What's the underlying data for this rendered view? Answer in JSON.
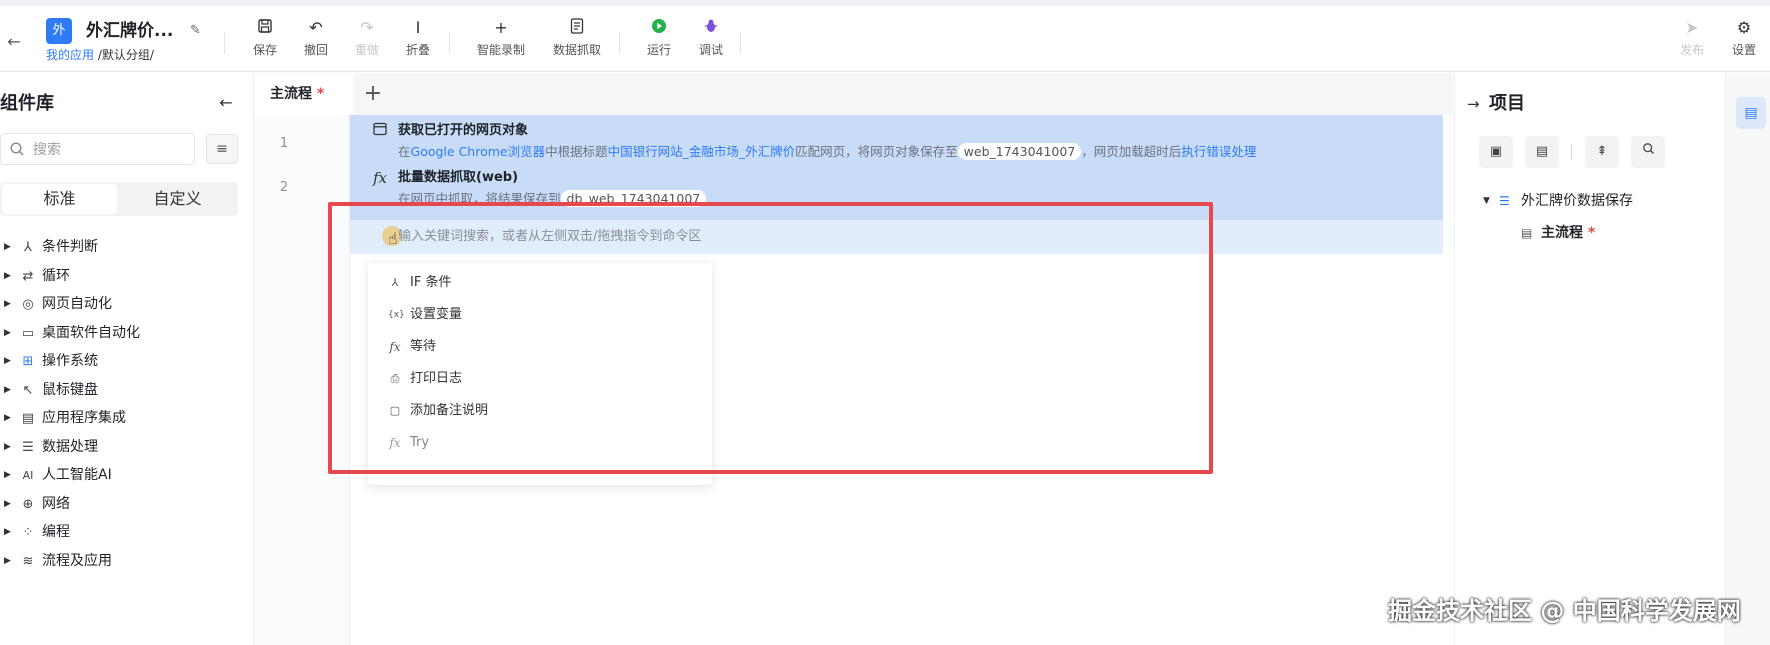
{
  "header": {
    "app_badge": "外",
    "app_name": "外汇牌价...",
    "breadcrumb_link": "我的应用",
    "breadcrumb_rest": " /默认分组/",
    "toolbar": [
      {
        "label": "保存",
        "icon": "save-icon"
      },
      {
        "label": "撤回",
        "icon": "undo-icon"
      },
      {
        "label": "重做",
        "icon": "redo-icon",
        "disabled": true
      },
      {
        "label": "折叠",
        "icon": "collapse-icon"
      },
      {
        "label": "智能录制",
        "icon": "plus-icon"
      },
      {
        "label": "数据抓取",
        "icon": "document-icon"
      },
      {
        "label": "运行",
        "icon": "play-icon",
        "color": "#22b14c"
      },
      {
        "label": "调试",
        "icon": "bug-icon",
        "color": "#7b4fe0"
      },
      {
        "label": "发布",
        "icon": "send-icon",
        "disabled": true
      },
      {
        "label": "设置",
        "icon": "gear-icon"
      }
    ]
  },
  "left": {
    "title": "组件库",
    "search_placeholder": "搜索",
    "tabs": [
      "标准",
      "自定义"
    ],
    "categories": [
      {
        "label": "条件判断",
        "icon": "branch-icon"
      },
      {
        "label": "循环",
        "icon": "loop-icon"
      },
      {
        "label": "网页自动化",
        "icon": "chrome-icon"
      },
      {
        "label": "桌面软件自动化",
        "icon": "monitor-icon"
      },
      {
        "label": "操作系统",
        "icon": "windows-icon"
      },
      {
        "label": "鼠标键盘",
        "icon": "cursor-icon"
      },
      {
        "label": "应用程序集成",
        "icon": "app-integration-icon"
      },
      {
        "label": "数据处理",
        "icon": "database-icon"
      },
      {
        "label": "人工智能AI",
        "icon": "ai-icon"
      },
      {
        "label": "网络",
        "icon": "globe-icon"
      },
      {
        "label": "编程",
        "icon": "code-icon"
      },
      {
        "label": "流程及应用",
        "icon": "layers-icon"
      }
    ]
  },
  "editor": {
    "tab_label": "主流程",
    "tab_marker": " *",
    "line_numbers": [
      "1",
      "2"
    ],
    "cmd1": {
      "title": "获取已打开的网页对象",
      "d1": "在",
      "d2": "Google Chrome浏览器",
      "d3": "中根据标题",
      "d4": "中国银行网站_金融市场_外汇牌价",
      "d5": "匹配网页，将网页对象保存至",
      "d6": "web_1743041007",
      "d7": "，网页加载超时后",
      "d8": "执行错误处理"
    },
    "cmd2": {
      "title": "批量数据抓取(web)",
      "d1": "在网页中抓取，将结果保存到",
      "d2": "db_web_1743041007"
    },
    "input_placeholder": "输入关键词搜索，或者从左侧双击/拖拽指令到命令区",
    "dropdown": [
      {
        "label": "IF 条件",
        "icon": "branch-icon"
      },
      {
        "label": "设置变量",
        "icon": "variable-icon"
      },
      {
        "label": "等待",
        "icon": "function-icon"
      },
      {
        "label": "打印日志",
        "icon": "printer-icon"
      },
      {
        "label": "添加备注说明",
        "icon": "note-icon"
      },
      {
        "label": "Try",
        "icon": "function-icon"
      }
    ]
  },
  "right": {
    "title": "项目",
    "tree_root": "外汇牌价数据保存",
    "tree_child": "主流程",
    "tree_child_marker": " *"
  },
  "watermark": "掘金技术社区 @ 中国科学发展网",
  "colors": {
    "accent": "#2f7bf5",
    "highlight": "#e5484d",
    "selected_row": "#c8dcf7"
  }
}
